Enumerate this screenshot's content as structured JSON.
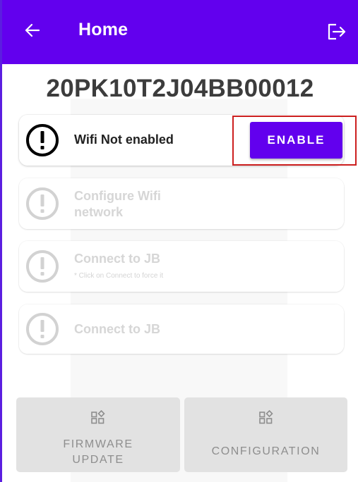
{
  "appbar": {
    "title": "Home",
    "back_icon": "arrow-left-icon",
    "logout_icon": "logout-icon"
  },
  "device": {
    "id": "20PK10T2J04BB00012"
  },
  "steps": [
    {
      "label": "Wifi Not enabled",
      "icon": "alert-circle-icon",
      "enabled": true,
      "action_label": "ENABLE"
    },
    {
      "label": "Configure Wifi network",
      "icon": "alert-circle-icon",
      "enabled": false
    },
    {
      "label": "Connect to JB",
      "sub": "* Click on Connect to force it",
      "icon": "alert-circle-icon",
      "enabled": false
    },
    {
      "label": "Connect to JB",
      "icon": "alert-circle-icon",
      "enabled": false
    }
  ],
  "bottom_actions": [
    {
      "label": "FIRMWARE UPDATE",
      "icon": "widgets-icon"
    },
    {
      "label": "CONFIGURATION",
      "icon": "widgets-icon"
    }
  ],
  "colors": {
    "primary": "#6200ee",
    "highlight_border": "#cc1f1f",
    "disabled_text": "#d6d6d6",
    "bottom_button_bg": "#e2e2e2"
  }
}
